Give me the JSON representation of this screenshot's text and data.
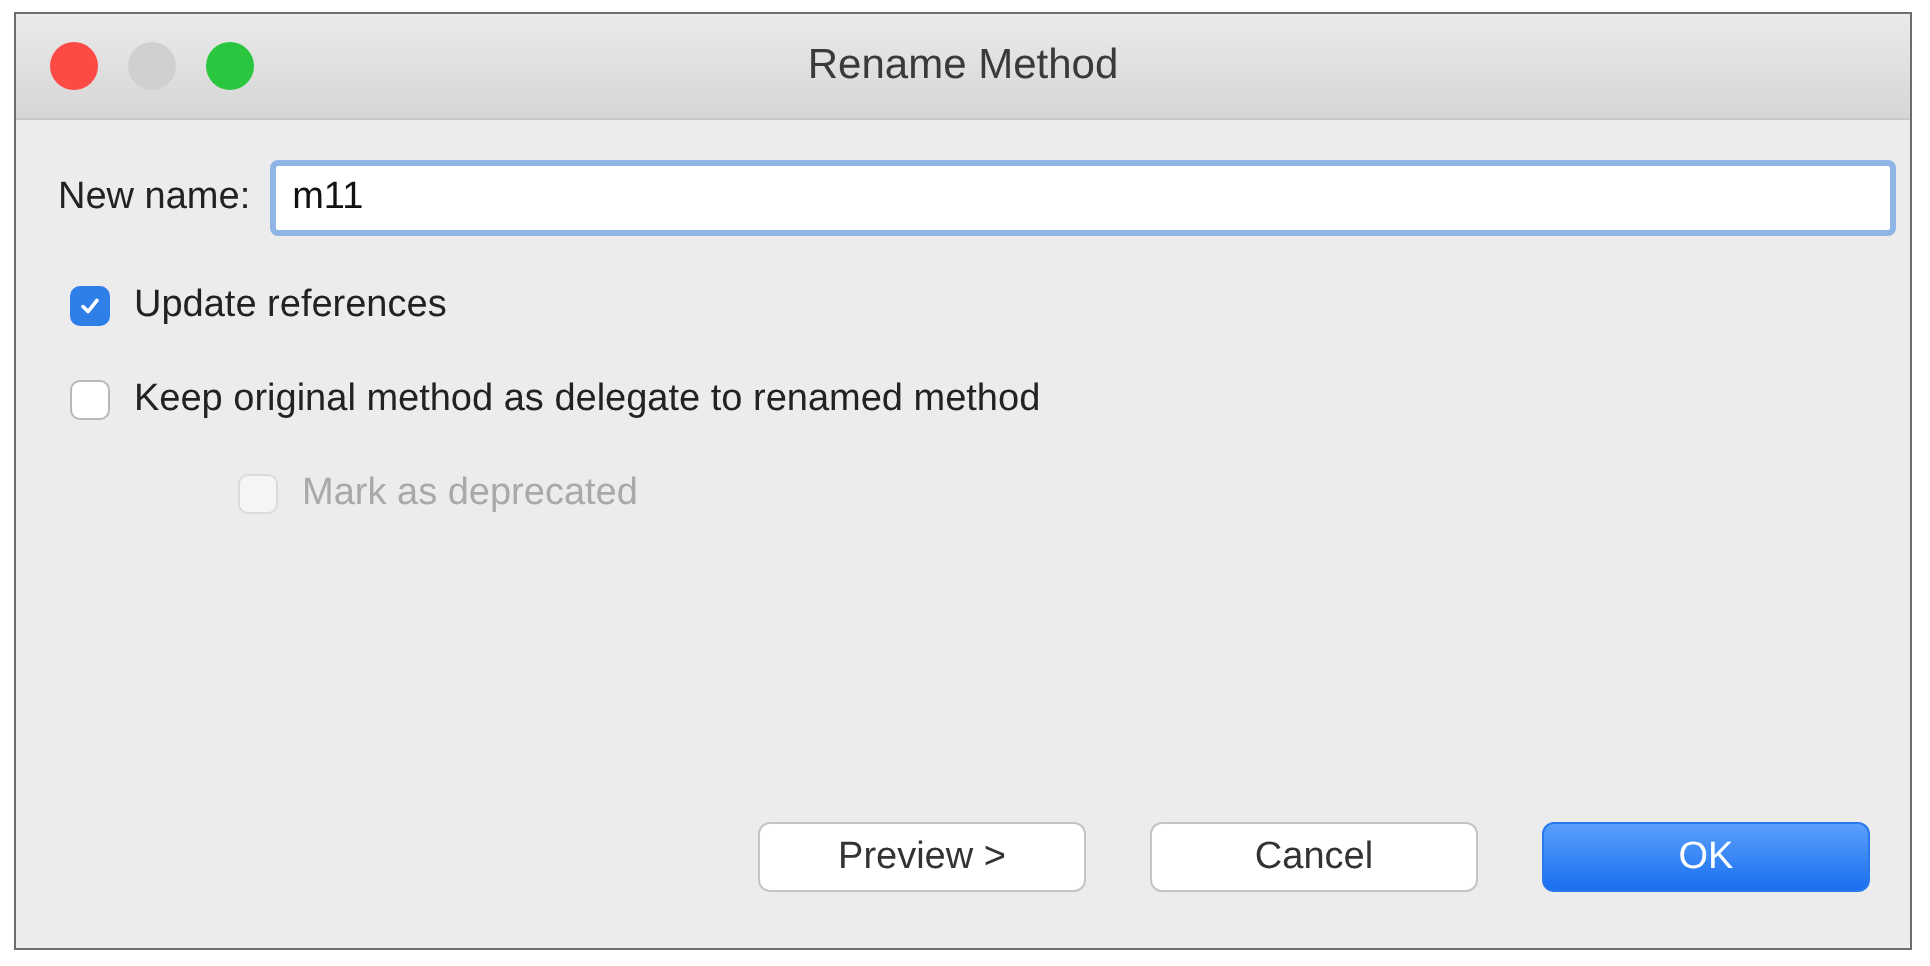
{
  "window": {
    "title": "Rename Method"
  },
  "new_name": {
    "label": "New name:",
    "value": "m11"
  },
  "options": [
    {
      "label": "Update references",
      "checked": true,
      "disabled": false
    },
    {
      "label": "Keep original method as delegate to renamed method",
      "checked": false,
      "disabled": false,
      "children": [
        {
          "label": "Mark as deprecated",
          "checked": false,
          "disabled": true
        }
      ]
    }
  ],
  "buttons": [
    {
      "label": "Preview >",
      "kind": "secondary"
    },
    {
      "label": "Cancel",
      "kind": "secondary"
    },
    {
      "label": "OK",
      "kind": "primary"
    }
  ]
}
